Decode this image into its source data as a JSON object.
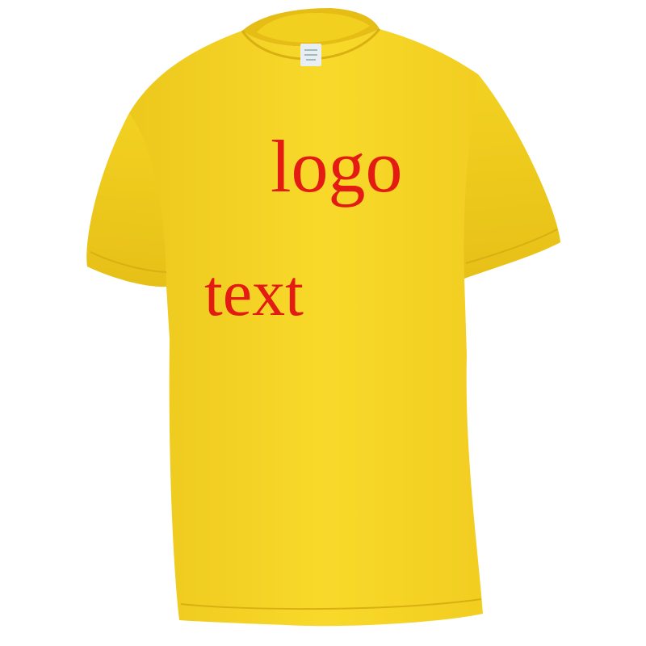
{
  "product": {
    "shirt_color": "#f5d420",
    "print_color": "#e41b13",
    "print_lines": {
      "logo": "logo",
      "text": "text"
    }
  }
}
